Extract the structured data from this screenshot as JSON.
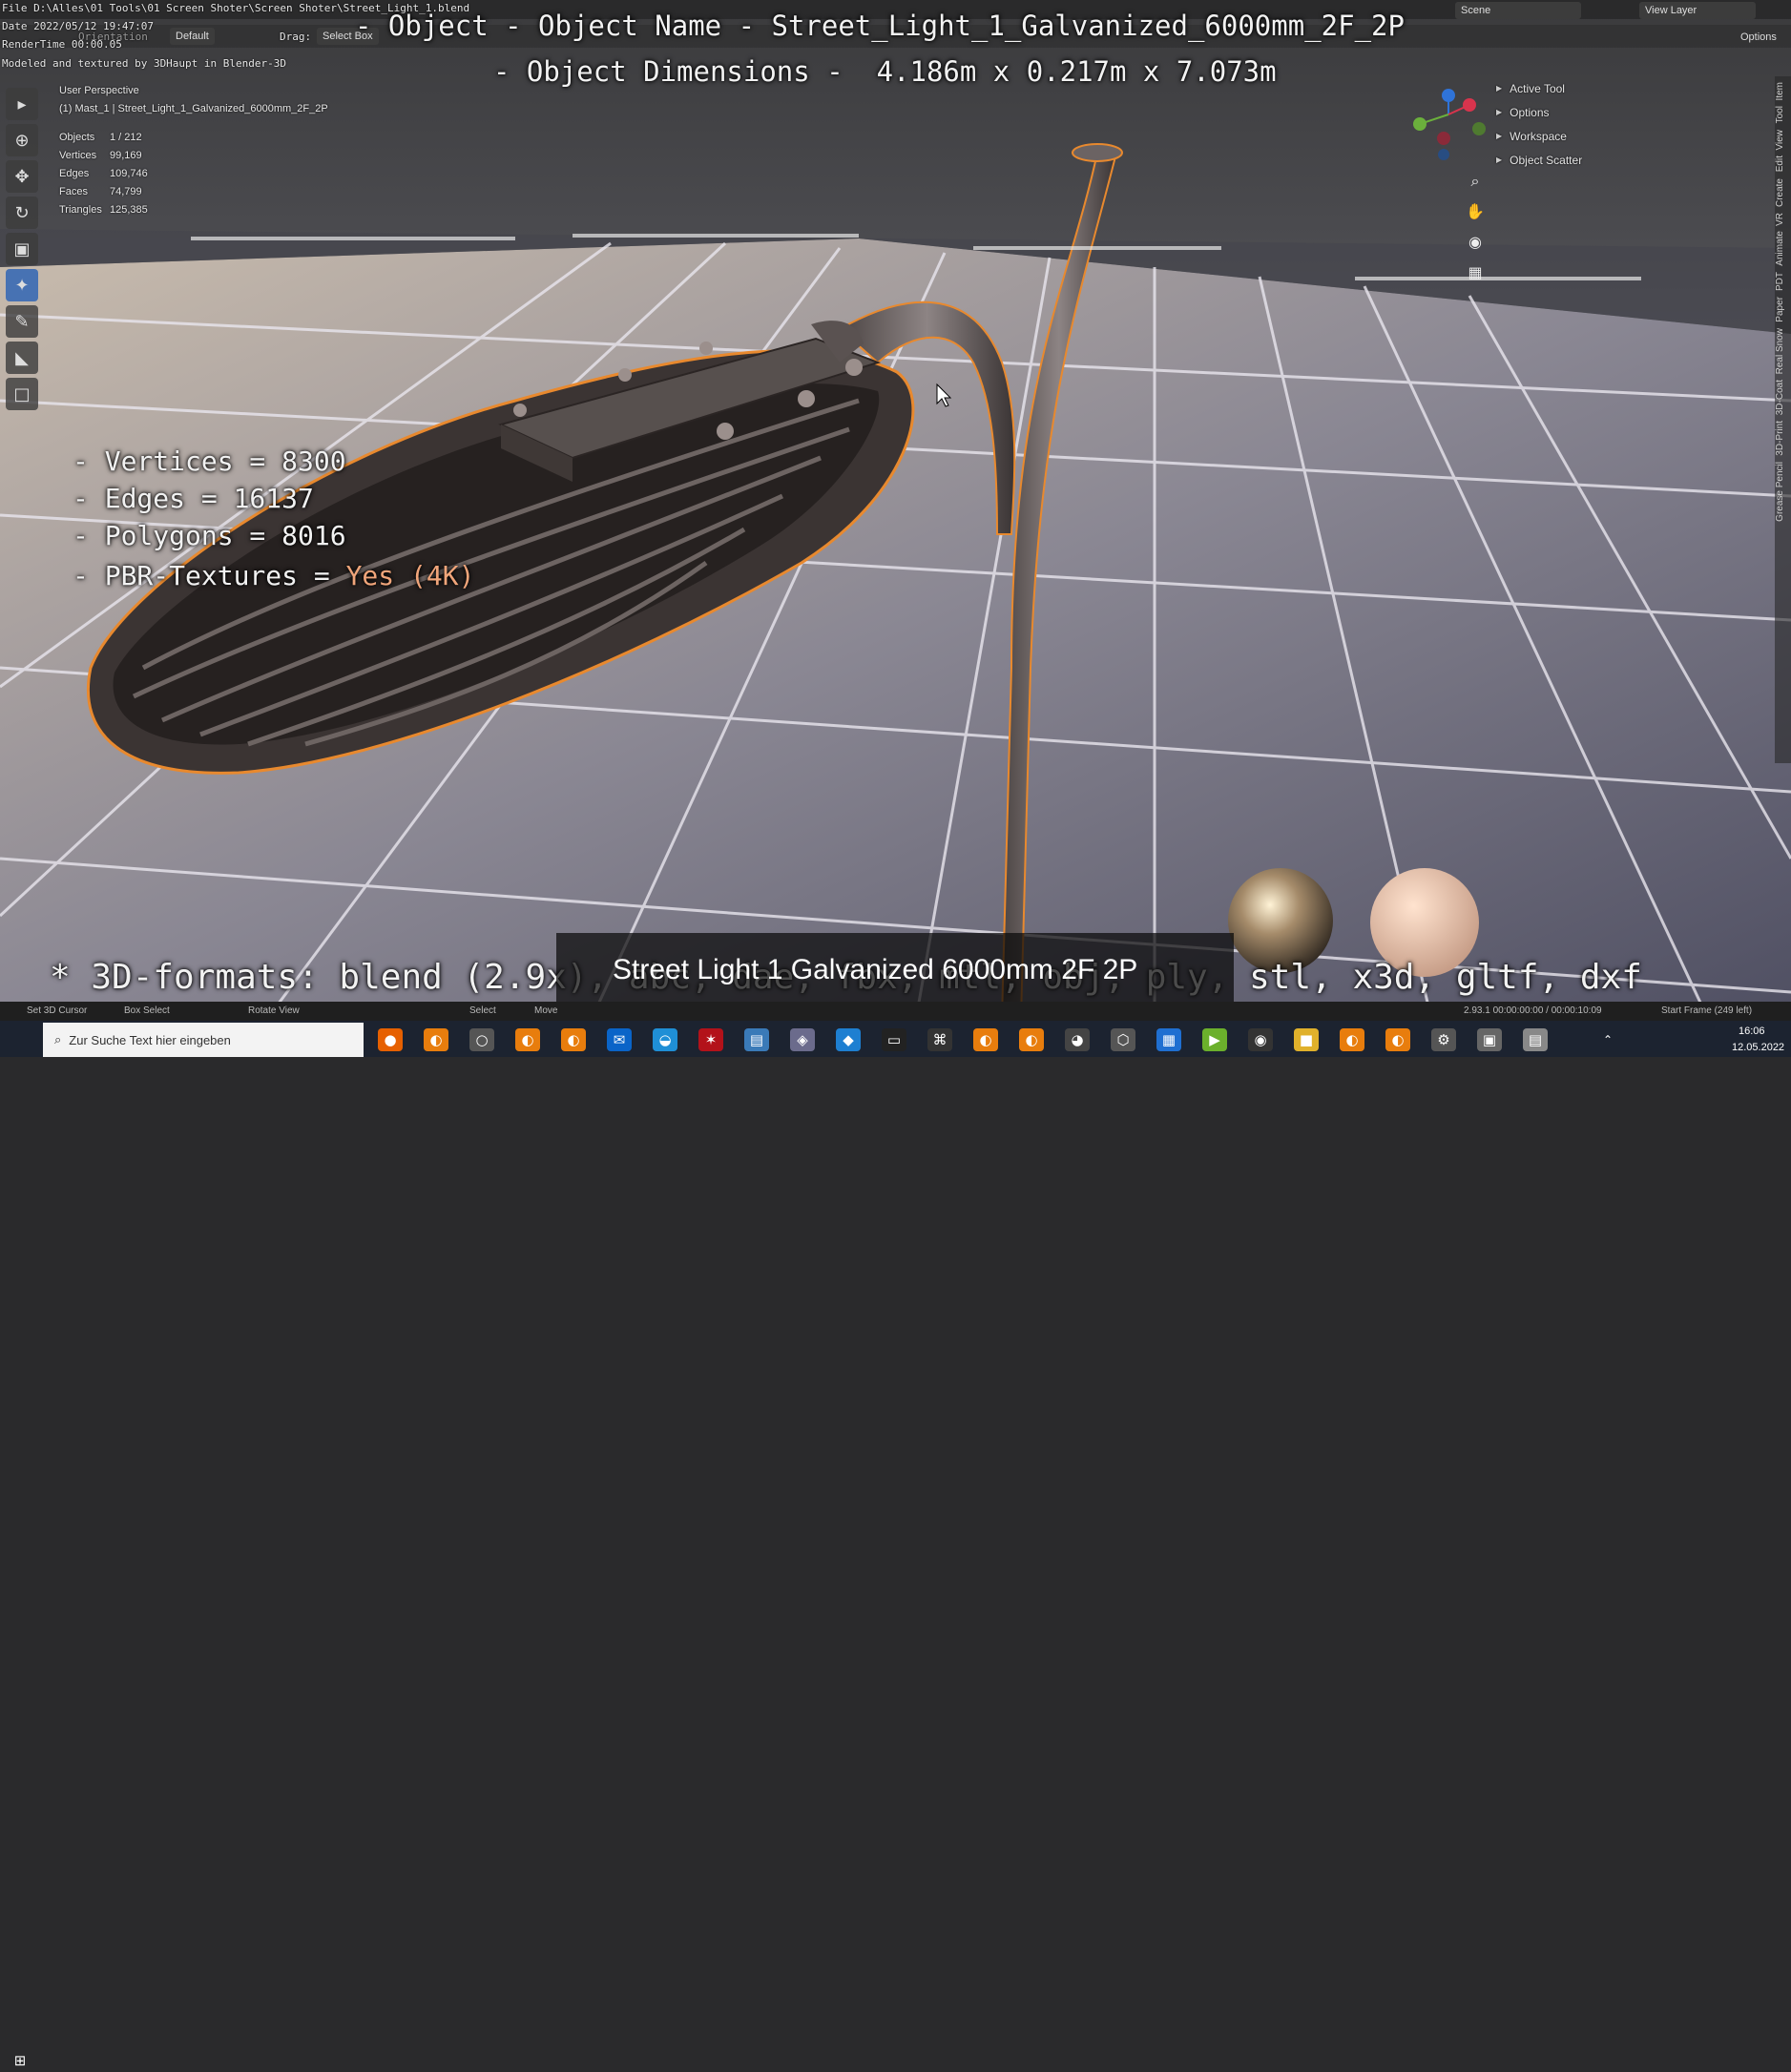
{
  "window": {
    "file_path": "File D:\\Alles\\01 Tools\\01 Screen Shoter\\Screen Shoter\\Street_Light_1.blend",
    "date": "Date 2022/05/12 19:47:07",
    "render_time": "RenderTime 00:00.05",
    "modeled_by": "Modeled and textured by 3DHaupt in Blender-3D"
  },
  "overlay": {
    "object_name": "- Object - Object Name - Street_Light_1_Galvanized_6000mm_2F_2P",
    "object_dimensions": "- Object Dimensions -  4.186m x 0.217m x 7.073m",
    "vertices": "- Vertices = 8300",
    "edges": "- Edges = 16137",
    "polygons": "- Polygons = 8016",
    "pbr_label": "- PBR-Textures = ",
    "pbr_value": "Yes (4K)",
    "formats": "* 3D-formats: blend (2.9x), abc, dae, fbx, mtl, obj, ply, stl, x3d, gltf, dxf",
    "caption": "Street Light 1 Galvanized 6000mm 2F 2P"
  },
  "header": {
    "orientation_label": "Orientation",
    "default_label": "Default",
    "drag_label": "Drag:",
    "select_box": "Select Box",
    "scene": "Scene",
    "view_layer": "View Layer",
    "options": "Options"
  },
  "viewport": {
    "perspective": "User Perspective",
    "object_path": "(1) Mast_1 | Street_Light_1_Galvanized_6000mm_2F_2P",
    "stats": [
      {
        "label": "Objects",
        "value": "1 / 212"
      },
      {
        "label": "Vertices",
        "value": "99,169"
      },
      {
        "label": "Edges",
        "value": "109,746"
      },
      {
        "label": "Faces",
        "value": "74,799"
      },
      {
        "label": "Triangles",
        "value": "125,385"
      }
    ]
  },
  "npanel": {
    "items": [
      "Active Tool",
      "Options",
      "Workspace",
      "Object Scatter"
    ]
  },
  "sidetabs": [
    "Item",
    "Tool",
    "View",
    "Edit",
    "Create",
    "VR",
    "Animate",
    "PDT",
    "Paper",
    "Real Snow",
    "3D-Coat",
    "3D-Print",
    "Grease Pencil"
  ],
  "statusbar": {
    "set_cursor": "Set 3D Cursor",
    "box_select": "Box Select",
    "rotate_view": "Rotate View",
    "select": "Select",
    "move": "Move",
    "version": "2.93.1  00:00:00:00 / 00:00:10:09",
    "start_frame": "Start Frame (249 left)"
  },
  "taskbar": {
    "search_placeholder": "Zur Suche Text hier eingeben",
    "time": "16:06",
    "date": "12.05.2022"
  },
  "colors": {
    "accent": "#4772b3",
    "selection_outline": "#e8892e"
  }
}
